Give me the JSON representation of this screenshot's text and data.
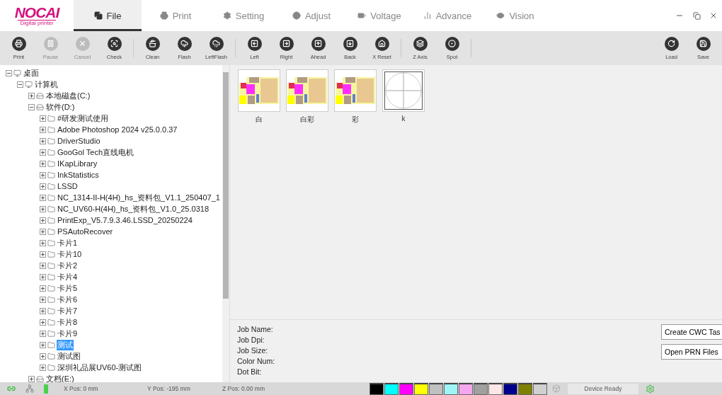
{
  "logo": {
    "name": "NOCAI",
    "tagline": "Digital printer"
  },
  "tabs": [
    {
      "label": "File",
      "selected": true
    },
    {
      "label": "Print",
      "selected": false
    },
    {
      "label": "Setting",
      "selected": false
    },
    {
      "label": "Adjust",
      "selected": false
    },
    {
      "label": "Voltage",
      "selected": false
    },
    {
      "label": "Advance",
      "selected": false
    },
    {
      "label": "Vision",
      "selected": false
    }
  ],
  "toolbar": {
    "groups": [
      [
        {
          "label": "Print",
          "disabled": false
        },
        {
          "label": "Pause",
          "disabled": true
        },
        {
          "label": "Cancel",
          "disabled": true
        },
        {
          "label": "Check",
          "disabled": false
        }
      ],
      [
        {
          "label": "Clean",
          "disabled": false
        },
        {
          "label": "Flash",
          "disabled": false
        },
        {
          "label": "LeftFlash",
          "disabled": false
        }
      ],
      [
        {
          "label": "Left",
          "disabled": false
        },
        {
          "label": "Right",
          "disabled": false
        },
        {
          "label": "Ahead",
          "disabled": false
        },
        {
          "label": "Back",
          "disabled": false
        },
        {
          "label": "X Reset",
          "disabled": false
        }
      ],
      [
        {
          "label": "Z Axis",
          "disabled": false
        },
        {
          "label": "Spot",
          "disabled": false
        }
      ]
    ],
    "right": [
      {
        "label": "Load",
        "disabled": false
      },
      {
        "label": "Save",
        "disabled": false
      }
    ]
  },
  "tree": [
    {
      "label": "桌面",
      "kind": "monitor",
      "expanded": true,
      "selected": false,
      "children": [
        {
          "label": "计算机",
          "kind": "monitor",
          "expanded": true,
          "selected": false,
          "children": [
            {
              "label": "本地磁盘(C:)",
              "kind": "drive",
              "expanded": false,
              "selected": false
            },
            {
              "label": "软件(D:)",
              "kind": "drive",
              "expanded": true,
              "selected": false,
              "children": [
                {
                  "label": "#研发测试使用",
                  "kind": "folder",
                  "expanded": false,
                  "selected": false
                },
                {
                  "label": "Adobe Photoshop 2024 v25.0.0.37",
                  "kind": "folder",
                  "expanded": false,
                  "selected": false
                },
                {
                  "label": "DriverStudio",
                  "kind": "folder",
                  "expanded": false,
                  "selected": false
                },
                {
                  "label": "GooGol Tech直线电机",
                  "kind": "folder",
                  "expanded": false,
                  "selected": false
                },
                {
                  "label": "IKapLibrary",
                  "kind": "folder",
                  "expanded": false,
                  "selected": false
                },
                {
                  "label": "InkStatistics",
                  "kind": "folder",
                  "expanded": false,
                  "selected": false
                },
                {
                  "label": "LSSD",
                  "kind": "folder",
                  "expanded": false,
                  "selected": false
                },
                {
                  "label": "NC_1314-II-H(4H)_hs_资料包_V1.1_250407_1",
                  "kind": "folder",
                  "expanded": false,
                  "selected": false
                },
                {
                  "label": "NC_UV60-H(4H)_hs_资料包_V1.0_25.0318",
                  "kind": "folder",
                  "expanded": false,
                  "selected": false
                },
                {
                  "label": "PrintExp_V5.7.9.3.46.LSSD_20250224",
                  "kind": "folder",
                  "expanded": false,
                  "selected": false
                },
                {
                  "label": "PSAutoRecover",
                  "kind": "folder",
                  "expanded": false,
                  "selected": false
                },
                {
                  "label": "卡片1",
                  "kind": "folder",
                  "expanded": false,
                  "selected": false
                },
                {
                  "label": "卡片10",
                  "kind": "folder",
                  "expanded": false,
                  "selected": false
                },
                {
                  "label": "卡片2",
                  "kind": "folder",
                  "expanded": false,
                  "selected": false
                },
                {
                  "label": "卡片4",
                  "kind": "folder",
                  "expanded": false,
                  "selected": false
                },
                {
                  "label": "卡片5",
                  "kind": "folder",
                  "expanded": false,
                  "selected": false
                },
                {
                  "label": "卡片6",
                  "kind": "folder",
                  "expanded": false,
                  "selected": false
                },
                {
                  "label": "卡片7",
                  "kind": "folder",
                  "expanded": false,
                  "selected": false
                },
                {
                  "label": "卡片8",
                  "kind": "folder",
                  "expanded": false,
                  "selected": false
                },
                {
                  "label": "卡片9",
                  "kind": "folder",
                  "expanded": false,
                  "selected": false
                },
                {
                  "label": "测试",
                  "kind": "folder",
                  "expanded": false,
                  "selected": true
                },
                {
                  "label": "测试图",
                  "kind": "folder",
                  "expanded": false,
                  "selected": false
                },
                {
                  "label": "深圳礼品展UV60-测试图",
                  "kind": "folder",
                  "expanded": false,
                  "selected": false
                }
              ]
            },
            {
              "label": "文档(E:)",
              "kind": "drive",
              "expanded": false,
              "selected": false
            }
          ]
        }
      ]
    }
  ],
  "thumbnails": [
    {
      "label": "白",
      "kind": "image"
    },
    {
      "label": "白彩",
      "kind": "image"
    },
    {
      "label": "彩",
      "kind": "image"
    },
    {
      "label": "k",
      "kind": "blank"
    }
  ],
  "job_info": [
    "Job Name:",
    "Job Dpi:",
    "Job Size:",
    "Color Num:",
    "Dot Bit:"
  ],
  "actions": [
    "Create CWC Tas",
    "Open PRN Files"
  ],
  "status": {
    "x_pos": "X Pos: 0 mm",
    "y_pos": "Y Pos: -195 mm",
    "z_pos": "Z Pos: 0.00 mm",
    "device": "Device Ready",
    "inks": [
      {
        "color": "#000000"
      },
      {
        "color": "#00ffff"
      },
      {
        "color": "#ff00ff"
      },
      {
        "color": "#ffff00"
      },
      {
        "color": "#c0c0c0"
      },
      {
        "color": "#9ff5f5"
      },
      {
        "color": "#f5a8f0"
      },
      {
        "color": "#a0a0a0"
      },
      {
        "color": "#fde6e6"
      },
      {
        "color": "#00008b"
      },
      {
        "color": "#808000"
      },
      {
        "color": "#d0d0d0"
      }
    ]
  }
}
